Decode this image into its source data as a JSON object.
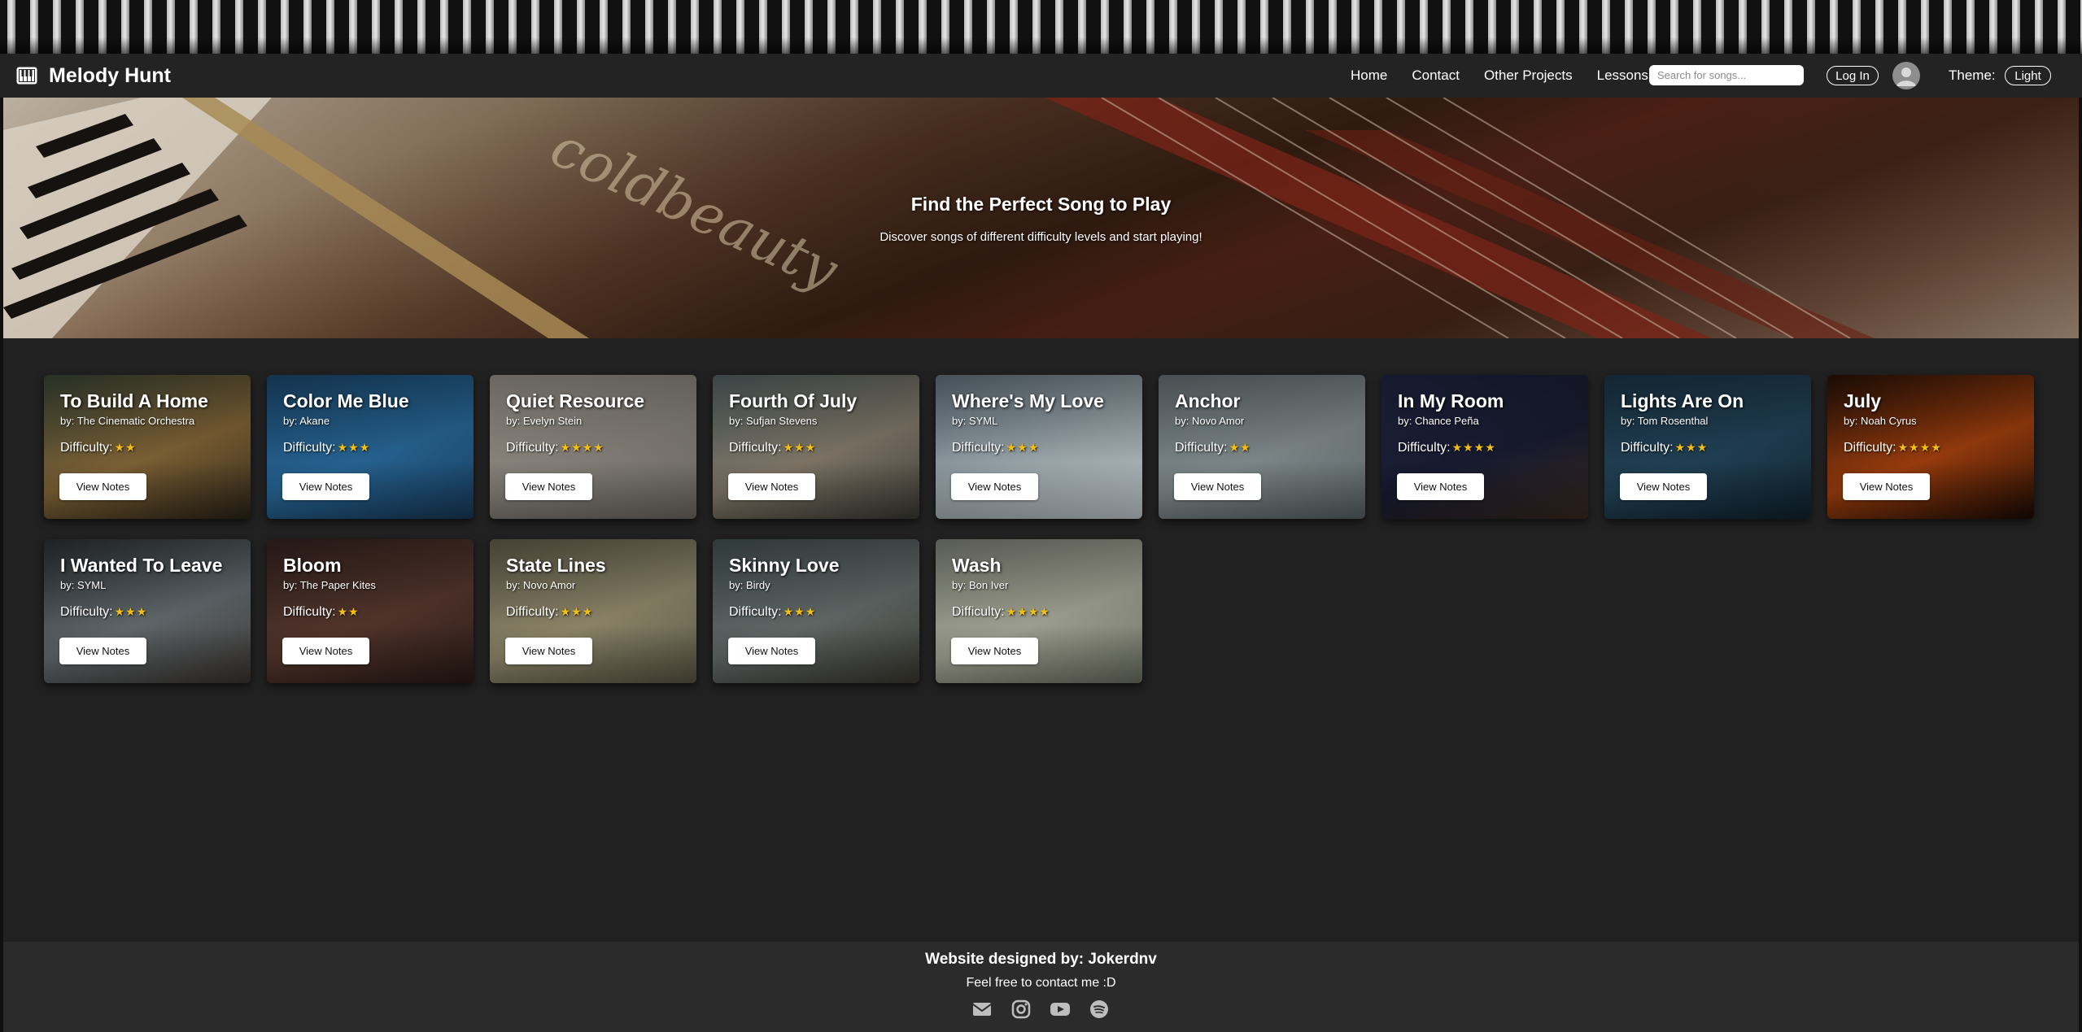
{
  "brand": {
    "name": "Melody Hunt",
    "icon": "piano-icon"
  },
  "nav": {
    "links": [
      "Home",
      "Contact",
      "Other Projects",
      "Lessons"
    ],
    "search_placeholder": "Search for songs...",
    "login_label": "Log In",
    "theme_label": "Theme:",
    "theme_button": "Light"
  },
  "hero": {
    "title": "Find the Perfect Song to Play",
    "subtitle": "Discover songs of different difficulty levels and start playing!"
  },
  "difficulty_label": "Difficulty:",
  "view_button_label": "View Notes",
  "songs": [
    {
      "title": "To Build A Home",
      "artist": "by: The Cinematic Orchestra",
      "stars": "★★",
      "difficulty": 2,
      "bg": [
        "#3d4a3a",
        "#8a6a3a",
        "#2a2418"
      ]
    },
    {
      "title": "Color Me Blue",
      "artist": "by: Akane",
      "stars": "★★★",
      "difficulty": 3,
      "bg": [
        "#1e4f78",
        "#2a6da0",
        "#173a5a"
      ]
    },
    {
      "title": "Quiet Resource",
      "artist": "by: Evelyn Stein",
      "stars": "★★★★",
      "difficulty": 4,
      "bg": [
        "#a49e94",
        "#8f8a82",
        "#6e6a64"
      ]
    },
    {
      "title": "Fourth Of July",
      "artist": "by: Sufjan Stevens",
      "stars": "★★★",
      "difficulty": 3,
      "bg": [
        "#5a6a6a",
        "#8a8070",
        "#3a3a34"
      ]
    },
    {
      "title": "Where's My Love",
      "artist": "by: SYML",
      "stars": "★★★",
      "difficulty": 3,
      "bg": [
        "#6a7a86",
        "#a8b4ba",
        "#c9d2d6"
      ]
    },
    {
      "title": "Anchor",
      "artist": "by: Novo Amor",
      "stars": "★★",
      "difficulty": 2,
      "bg": [
        "#6f7a7e",
        "#8a9496",
        "#5a6466"
      ]
    },
    {
      "title": "In My Room",
      "artist": "by: Chance Peña",
      "stars": "★★★★",
      "difficulty": 4,
      "bg": [
        "#232847",
        "#1a1d34",
        "#3a2a20"
      ]
    },
    {
      "title": "Lights Are On",
      "artist": "by: Tom Rosenthal",
      "stars": "★★★",
      "difficulty": 3,
      "bg": [
        "#1d3a4e",
        "#24465c",
        "#10222e"
      ]
    },
    {
      "title": "July",
      "artist": "by: Noah Cyrus",
      "stars": "★★★★",
      "difficulty": 4,
      "bg": [
        "#2a1208",
        "#a8420e",
        "#1a0a04"
      ]
    },
    {
      "title": "I Wanted To Leave",
      "artist": "by: SYML",
      "stars": "★★★",
      "difficulty": 3,
      "bg": [
        "#2e3438",
        "#6a7276",
        "#3a3430"
      ]
    },
    {
      "title": "Bloom",
      "artist": "by: The Paper Kites",
      "stars": "★★",
      "difficulty": 2,
      "bg": [
        "#3a2622",
        "#5a3a30",
        "#2a1a16"
      ]
    },
    {
      "title": "State Lines",
      "artist": "by: Novo Amor",
      "stars": "★★★",
      "difficulty": 3,
      "bg": [
        "#6a6450",
        "#9a9274",
        "#5a5644"
      ]
    },
    {
      "title": "Skinny Love",
      "artist": "by: Birdy",
      "stars": "★★★",
      "difficulty": 3,
      "bg": [
        "#4a5858",
        "#6a7270",
        "#3a3830"
      ]
    },
    {
      "title": "Wash",
      "artist": "by: Bon Iver",
      "stars": "★★★★",
      "difficulty": 4,
      "bg": [
        "#8a8e82",
        "#aeb0a0",
        "#6e7264"
      ]
    }
  ],
  "footer": {
    "title": "Website designed by: Jokerdnv",
    "subtitle": "Feel free to contact me :D",
    "icons": [
      "email-icon",
      "instagram-icon",
      "youtube-icon",
      "spotify-icon"
    ]
  },
  "colors": {
    "background": "#212121",
    "navbar": "#232323",
    "footer": "#2b2b2b",
    "star": "#f3c012"
  }
}
